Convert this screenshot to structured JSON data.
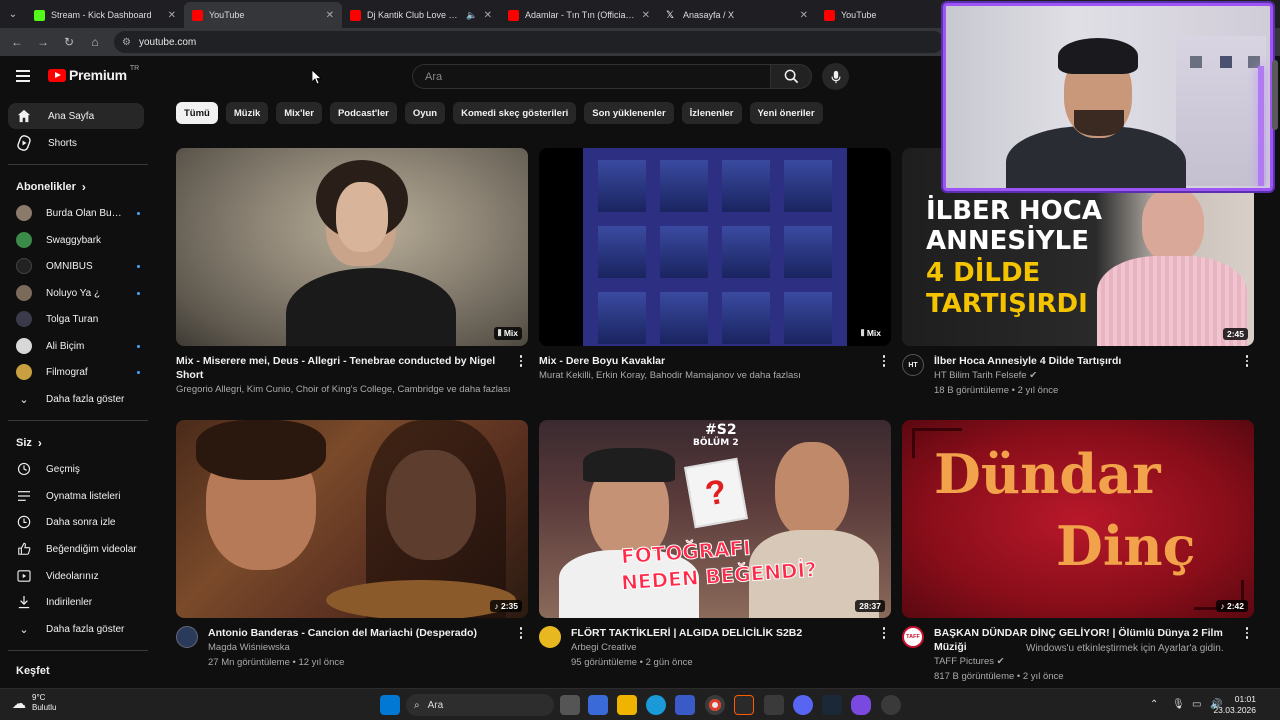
{
  "browser": {
    "tabs": [
      {
        "title": "Stream - Kick Dashboard",
        "favicon_color": "#53fc18",
        "active": false
      },
      {
        "title": "YouTube",
        "favicon_color": "#ff0000",
        "active": true
      },
      {
        "title": "Dj Kantik Club Love Bubbling",
        "favicon_color": "#ff0000",
        "active": false
      },
      {
        "title": "Adamlar - Tın Tın (Official Audio)",
        "favicon_color": "#ff0000",
        "active": false
      },
      {
        "title": "Anasayfa / X",
        "favicon_color": "#ffffff",
        "active": false
      },
      {
        "title": "YouTube",
        "favicon_color": "#ff0000",
        "active": false
      }
    ],
    "url": "youtube.com"
  },
  "header": {
    "logo_text": "Premium",
    "logo_region": "TR",
    "search_placeholder": "Ara"
  },
  "sidebar": {
    "main": [
      {
        "label": "Ana Sayfa",
        "icon": "home-icon"
      },
      {
        "label": "Shorts",
        "icon": "shorts-icon"
      }
    ],
    "subscriptions_title": "Abonelikler",
    "subscriptions": [
      {
        "name": "Burda Olan Burd...",
        "color": "#8a7a6a",
        "dot": true
      },
      {
        "name": "Swaggybark",
        "color": "#3a8a4a",
        "dot": false
      },
      {
        "name": "OMNIBUS",
        "color": "#222222",
        "dot": true
      },
      {
        "name": "Noluyo Ya ¿",
        "color": "#7a6a5a",
        "dot": true
      },
      {
        "name": "Tolga Turan",
        "color": "#3a3a4a",
        "dot": false
      },
      {
        "name": "Ali Biçim",
        "color": "#d8d8d8",
        "dot": true
      },
      {
        "name": "Filmograf",
        "color": "#c8a040",
        "dot": true
      }
    ],
    "show_more_1": "Daha fazla göster",
    "you_title": "Siz",
    "you_items": [
      {
        "label": "Geçmiş",
        "icon": "history-icon"
      },
      {
        "label": "Oynatma listeleri",
        "icon": "playlists-icon"
      },
      {
        "label": "Daha sonra izle",
        "icon": "watch-later-icon"
      },
      {
        "label": "Beğendiğim videolar",
        "icon": "like-icon"
      },
      {
        "label": "Videolarınız",
        "icon": "your-videos-icon"
      },
      {
        "label": "İndirilenler",
        "icon": "download-icon"
      }
    ],
    "show_more_2": "Daha fazla göster",
    "explore_title": "Keşfet"
  },
  "chips": [
    "Tümü",
    "Müzik",
    "Mix'ler",
    "Podcast'ler",
    "Oyun",
    "Komedi skeç gösterileri",
    "Son yüklenenler",
    "İzlenenler",
    "Yeni öneriler"
  ],
  "videos": [
    {
      "title": "Mix - Miserere mei, Deus - Allegri - Tenebrae conducted by Nigel Short",
      "channel": "Gregorio Allegri, Kim Cunio, Choir of King's College, Cambridge ve daha fazlası",
      "stats": "",
      "badge": "Mix",
      "avatar": false
    },
    {
      "title": "Mix - Dere Boyu Kavaklar",
      "channel": "Murat Kekilli, Erkin Koray, Bahodir Mamajanov ve daha fazlası",
      "stats": "",
      "badge": "Mix",
      "avatar": false
    },
    {
      "title": "İlber Hoca Annesiyle 4 Dilde Tartışırdı",
      "channel": "HT Bilim Tarih Felsefe",
      "stats": "18 B görüntüleme • 2 yıl önce",
      "badge": "2:45",
      "avatar": true,
      "avatar_text": "HT",
      "thumb_lines": [
        "İLBER HOCA",
        "ANNESİYLE",
        "4 DİLDE",
        "TARTIŞIRDI"
      ]
    },
    {
      "title": "Antonio Banderas - Cancion del Mariachi (Desperado)",
      "channel": "Magda Wiśniewska",
      "stats": "27 Mn görüntüleme • 12 yıl önce",
      "badge": "2:35",
      "avatar": true
    },
    {
      "title": "FLÖRT TAKTİKLERİ | ALGIDA DELİCİLİK S2B2",
      "channel": "Arbegi Creative",
      "stats": "95 görüntüleme • 2 gün önce",
      "badge": "28:37",
      "avatar": true,
      "thumb_lines": [
        "#S2",
        "BÖLÜM 2",
        "FOTOĞRAFI",
        "NEDEN BEĞENDİ?"
      ]
    },
    {
      "title": "BAŞKAN DÜNDAR DİNÇ GELİYOR! | Ölümlü Dünya 2 Film Müziği",
      "channel": "TAFF Pictures",
      "stats": "817 B görüntüleme • 2 yıl önce",
      "badge": "2:42",
      "avatar": true,
      "avatar_text": "TAFF",
      "thumb_lines": [
        "Dündar",
        "Dinç"
      ]
    }
  ],
  "activation_notice": "Windows'u etkinleştirmek için Ayarlar'a gidin.",
  "taskbar": {
    "weather_temp": "9°C",
    "weather_desc": "Bulutlu",
    "search_label": "Ara",
    "time": "01:01",
    "date": "23.03.2026"
  }
}
